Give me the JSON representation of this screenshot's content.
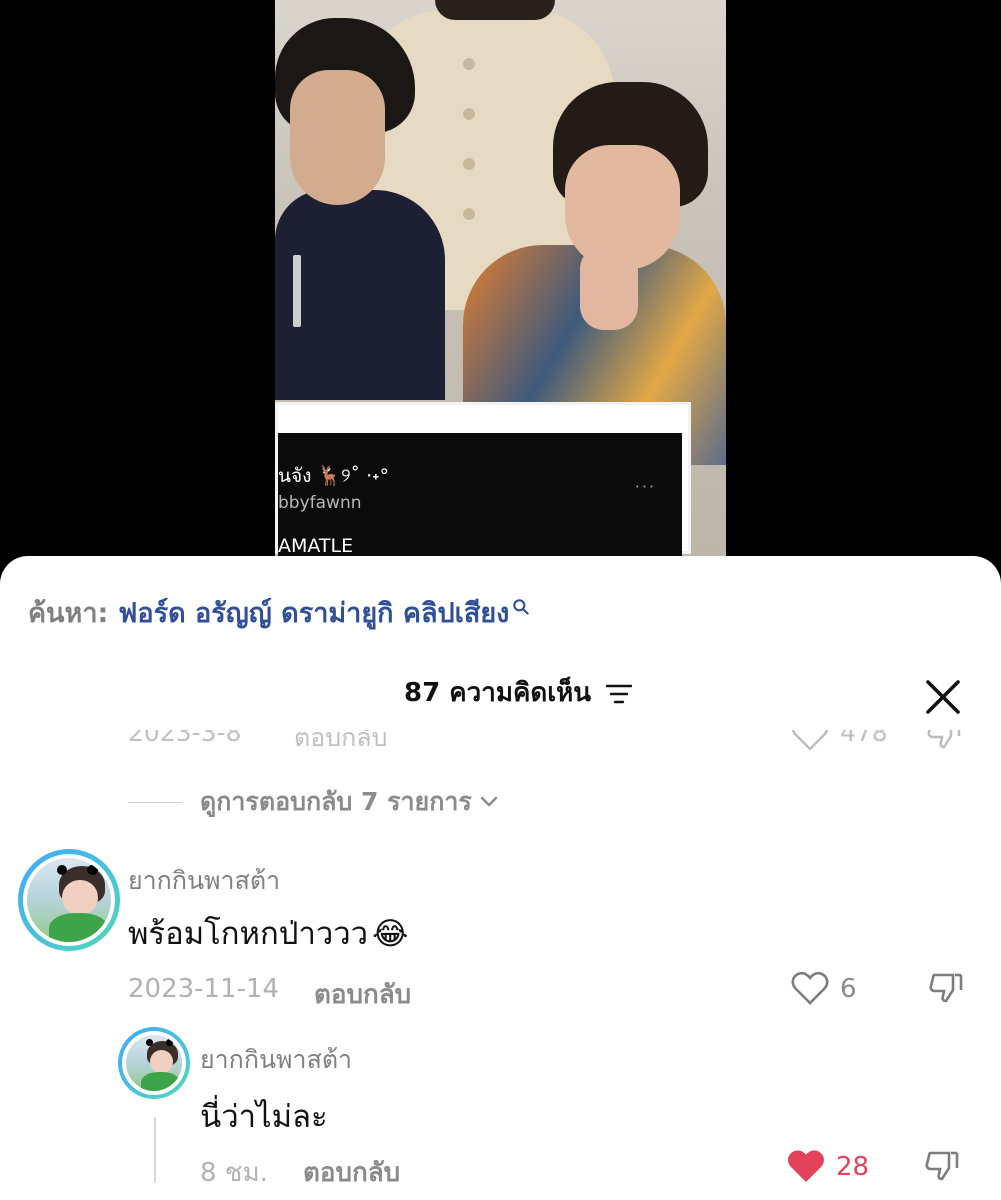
{
  "video": {
    "card": {
      "title": "นจัง 🦌୨˚ ·˖°",
      "subtitle": "bbyfawnn",
      "caption": "AMATLE",
      "menu": "···"
    }
  },
  "search": {
    "prefix": "ค้นหา:",
    "term": "ฟอร์ด อรัญญ์ ดราม่ายูกิ คลิปเสียง"
  },
  "header": {
    "comment_count": "87 ความคิดเห็น"
  },
  "previous_comment": {
    "date": "2023-3-8",
    "reply_label": "ตอบกลับ",
    "likes": "478"
  },
  "replies_toggle": {
    "label": "ดูการตอบกลับ 7 รายการ"
  },
  "comments": [
    {
      "username": "ยากกินพาสต้า",
      "text": "พร้อมโกหกป่าววว",
      "emoji": "😂",
      "date": "2023-11-14",
      "reply_label": "ตอบกลับ",
      "likes": "6"
    },
    {
      "username": "ยากกินพาสต้า",
      "text": "นี่ว่าไม่ละ",
      "date": "8 ชม.",
      "reply_label": "ตอบกลับ",
      "likes": "28"
    }
  ],
  "colors": {
    "accent_blue": "#2f4f97",
    "liked_red": "#e2425a"
  },
  "icons": {
    "search": "search-icon",
    "filter": "filter-icon",
    "close": "close-icon",
    "chevron": "chevron-down-icon",
    "heart": "heart-icon",
    "dislike": "dislike-icon"
  }
}
